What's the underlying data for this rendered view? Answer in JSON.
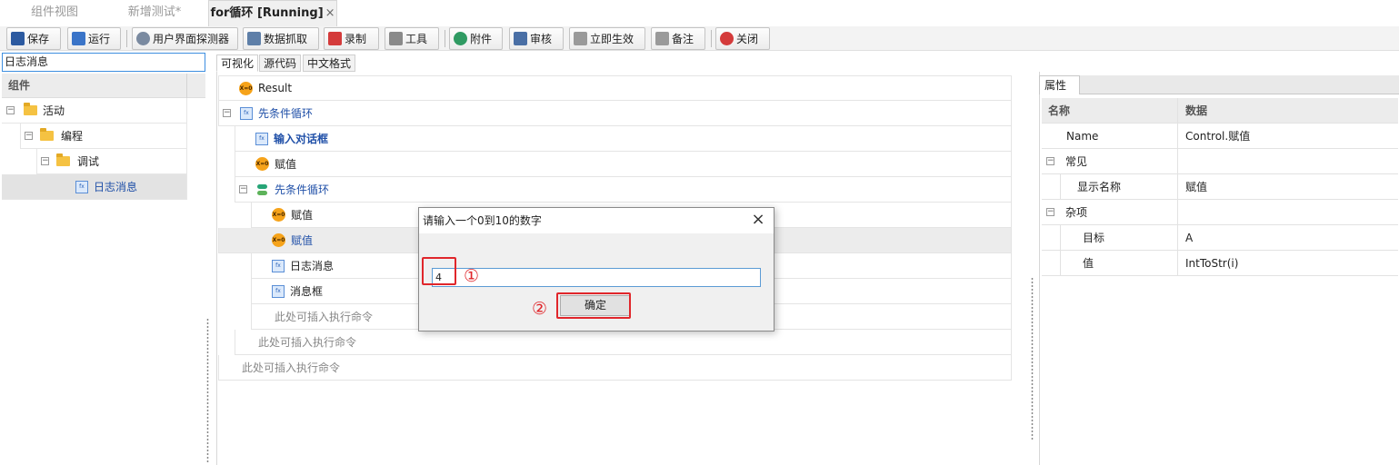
{
  "doc_tabs": [
    {
      "label": "组件视图",
      "active": false
    },
    {
      "label": "新增测试*",
      "active": false
    },
    {
      "label": "for循环 [Running]",
      "active": true,
      "close": "×"
    }
  ],
  "toolbar": {
    "buttons": [
      {
        "label": "保存",
        "icon": "save-icon",
        "color": "#2c5aa0"
      },
      {
        "label": "运行",
        "icon": "run-icon",
        "color": "#3a74c8"
      },
      {
        "label": "用户界面探测器",
        "icon": "search-icon",
        "color": "#7a8aa0"
      },
      {
        "label": "数据抓取",
        "icon": "table-icon",
        "color": "#5e7fa8"
      },
      {
        "label": "录制",
        "icon": "record-icon",
        "color": "#d43b3b"
      },
      {
        "label": "工具",
        "icon": "tools-icon",
        "color": "#8a8a8a"
      },
      {
        "label": "附件",
        "icon": "attachment-icon",
        "color": "#2f9a62"
      },
      {
        "label": "审核",
        "icon": "review-icon",
        "color": "#4a6fa5"
      },
      {
        "label": "立即生效",
        "icon": "apply-icon",
        "color": "#9a9a9a"
      },
      {
        "label": "备注",
        "icon": "note-icon",
        "color": "#9a9a9a"
      },
      {
        "label": "关闭",
        "icon": "close-icon",
        "color": "#d43b3b"
      }
    ]
  },
  "left_panel": {
    "search_value": "日志消息",
    "header": "组件",
    "tree": [
      {
        "label": "活动",
        "icon": "folder-icon",
        "toggle": "−"
      },
      {
        "label": "编程",
        "icon": "folder-icon",
        "toggle": "−"
      },
      {
        "label": "调试",
        "icon": "folder-icon",
        "toggle": "−"
      },
      {
        "label": "日志消息",
        "icon": "fx-icon",
        "selected": true
      }
    ]
  },
  "view_tabs": [
    {
      "label": "可视化",
      "active": true
    },
    {
      "label": "源代码",
      "active": false
    },
    {
      "label": "中文格式",
      "active": false
    }
  ],
  "canvas": {
    "rows": [
      {
        "label": "Result",
        "icon": "assign-icon",
        "icon_text": "X=0"
      },
      {
        "label": "先条件循环",
        "icon": "fx-icon",
        "toggle": "−",
        "style": "link"
      },
      {
        "label": "输入对话框",
        "icon": "fx-icon",
        "style": "bold"
      },
      {
        "label": "赋值",
        "icon": "assign-icon",
        "icon_text": "X=0"
      },
      {
        "label": "先条件循环",
        "icon": "loop-icon",
        "toggle": "−",
        "style": "link"
      },
      {
        "label": "赋值",
        "icon": "assign-icon",
        "icon_text": "X=0"
      },
      {
        "label": "赋值",
        "icon": "assign-icon",
        "icon_text": "X=0",
        "selected": true,
        "style": "link"
      },
      {
        "label": "日志消息",
        "icon": "fx-icon"
      },
      {
        "label": "消息框",
        "icon": "fx-icon"
      },
      {
        "label": "此处可插入执行命令",
        "style": "gray"
      },
      {
        "label": "此处可插入执行命令",
        "style": "gray"
      },
      {
        "label": "此处可插入执行命令",
        "style": "gray"
      }
    ]
  },
  "fx_icon_text": "fx",
  "properties": {
    "tab": "属性",
    "headers": [
      "名称",
      "数据"
    ],
    "rows": [
      {
        "name": "Name",
        "value": "Control.赋值"
      },
      {
        "name": "常见",
        "value": "",
        "group": true,
        "toggle": "−"
      },
      {
        "name": "显示名称",
        "value": "赋值"
      },
      {
        "name": "杂项",
        "value": "",
        "group": true,
        "toggle": "−"
      },
      {
        "name": "目标",
        "value": "A"
      },
      {
        "name": "值",
        "value": "IntToStr(i)"
      }
    ]
  },
  "dialog": {
    "title": "请输入一个0到10的数字",
    "close": "×",
    "input_value": "4",
    "ok_label": "确定",
    "marker1": "①",
    "marker2": "②"
  },
  "colors": {
    "highlight": "#e0262b",
    "link": "#2050a8",
    "focus": "#3d8ee0"
  }
}
